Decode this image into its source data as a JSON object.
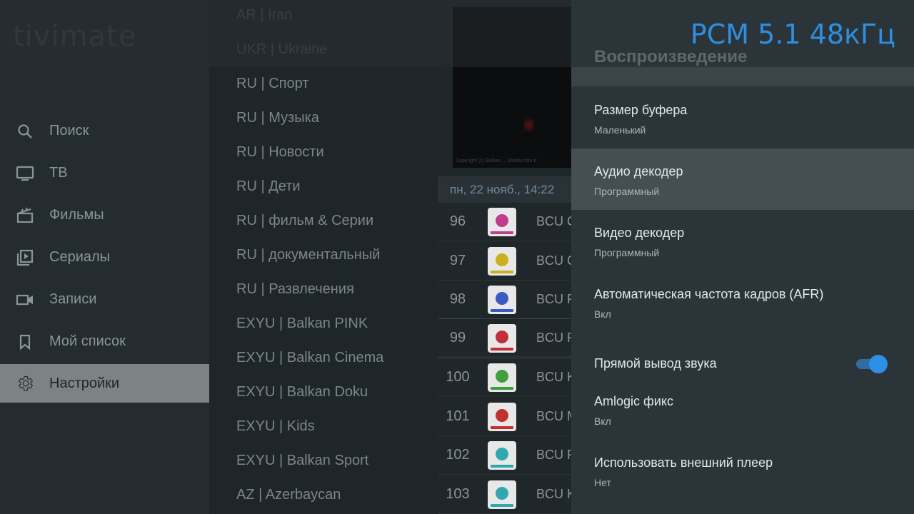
{
  "app": {
    "logo_text": "tivimate"
  },
  "sidebar": {
    "items": [
      {
        "label": "Поиск",
        "icon": "search-icon"
      },
      {
        "label": "ТВ",
        "icon": "tv-icon"
      },
      {
        "label": "Фильмы",
        "icon": "movies-icon"
      },
      {
        "label": "Сериалы",
        "icon": "series-icon"
      },
      {
        "label": "Записи",
        "icon": "recordings-icon"
      },
      {
        "label": "Мой список",
        "icon": "bookmark-icon"
      },
      {
        "label": "Настройки",
        "icon": "gear-icon",
        "active": true
      }
    ]
  },
  "groups": [
    "AR | Iran",
    "UKR | Ukraine",
    " RU | Спорт",
    "RU | Музыка",
    "RU | Новости",
    "RU | Дети",
    " RU | фильм & Серии",
    "RU | документальный",
    "RU | Развлечения",
    "EXYU | Balkan PINK",
    "EXYU | Balkan Cinema",
    "EXYU | Balkan Doku",
    "EXYU | Kids",
    "EXYU | Balkan Sport",
    "AZ | Azerbaycan"
  ],
  "preview": {
    "caption": "Copyright (c) Balkan ... Media.com.tr"
  },
  "epg": {
    "date_time": "пн, 22 нояб., 14:22"
  },
  "channels": [
    {
      "number": "96",
      "name": "BCU C",
      "color": "#c03c8c"
    },
    {
      "number": "97",
      "name": "BCU C",
      "color": "#c8b020"
    },
    {
      "number": "98",
      "name": "BCU F",
      "color": "#3a5cc0"
    },
    {
      "number": "99",
      "name": "BCU F",
      "color": "#c0303a"
    },
    {
      "number": "100",
      "name": "BCU K",
      "color": "#40a040"
    },
    {
      "number": "101",
      "name": "BCU M",
      "color": "#c03030"
    },
    {
      "number": "102",
      "name": "BCU F",
      "color": "#30a8b0"
    },
    {
      "number": "103",
      "name": "BCU K",
      "color": "#30a8b0"
    }
  ],
  "panel": {
    "audio_info": "PCM 5.1 48кГц",
    "title": "Воспроизведение",
    "settings": [
      {
        "label": "Размер буфера",
        "value": "Маленький"
      },
      {
        "label": "Аудио декодер",
        "value": "Программный",
        "focused": true
      },
      {
        "label": "Видео декодер",
        "value": "Программный"
      },
      {
        "label": "Автоматическая частота кадров (AFR)",
        "value": "Вкл"
      },
      {
        "label": "Прямой вывод звука",
        "toggle": true,
        "toggle_on": true
      },
      {
        "label": "Amlogic фикс",
        "value": "Вкл"
      },
      {
        "label": "Использовать внешний плеер",
        "value": "Нет"
      }
    ]
  },
  "colors": {
    "accent": "#2e8fe0",
    "active_nav": "#7d8285",
    "panel_bg": "#2b3439"
  }
}
